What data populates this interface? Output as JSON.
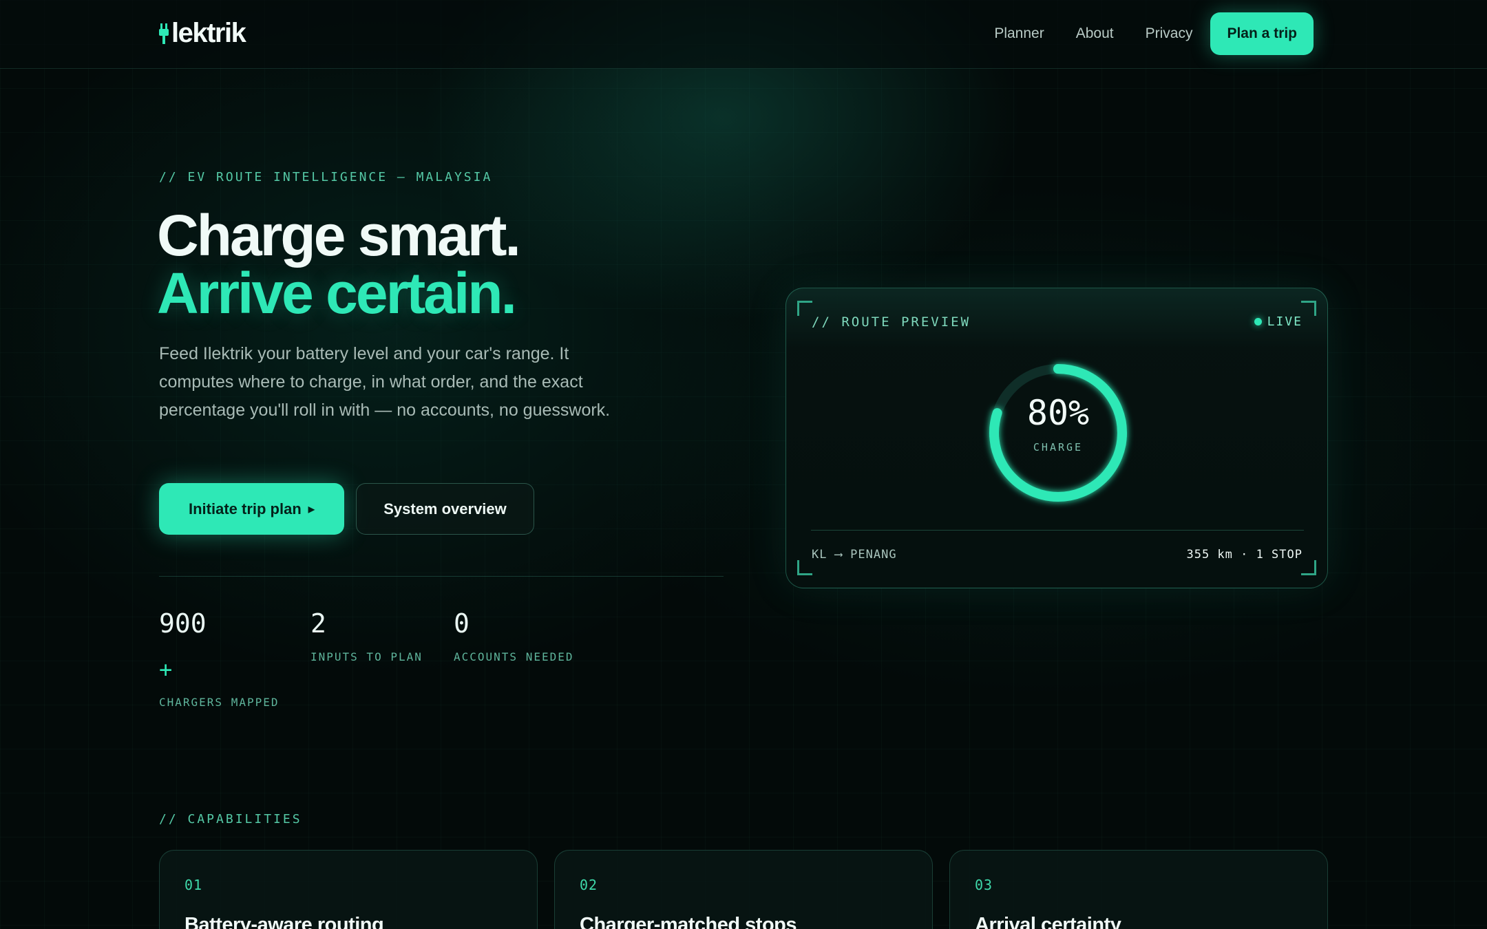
{
  "brand": {
    "name": "lektrik",
    "accent": "#2ee8b6",
    "background": "#030a09"
  },
  "nav": {
    "links": [
      "Planner",
      "About",
      "Privacy"
    ],
    "cta": "Plan a trip"
  },
  "hero": {
    "eyebrow": "// EV ROUTE INTELLIGENCE — MALAYSIA",
    "headline_1": "Charge smart.",
    "headline_2": "Arrive certain.",
    "lede": "Feed Ilektrik your battery level and your car's range. It computes where to charge, in what order, and the exact percentage you'll roll in with — no accounts, no guesswork.",
    "primary_cta": "Initiate trip plan",
    "primary_cta_icon": "play-triangle-icon",
    "secondary_cta": "System overview"
  },
  "stats": [
    {
      "value": "900",
      "suffix": "+",
      "label": "CHARGERS MAPPED"
    },
    {
      "value": "2",
      "label": "INPUTS TO PLAN"
    },
    {
      "value": "0",
      "label": "ACCOUNTS NEEDED"
    }
  ],
  "preview": {
    "title": "// ROUTE PREVIEW",
    "status": "LIVE",
    "charge_text": "80%",
    "charge_fraction": 0.8,
    "charge_label": "CHARGE",
    "route": "KL ⟶ PENANG",
    "summary": "355 km · 1 STOP"
  },
  "capabilities": {
    "eyebrow": "// CAPABILITIES",
    "items": [
      {
        "num": "01",
        "title": "Battery-aware routing"
      },
      {
        "num": "02",
        "title": "Charger-matched stops"
      },
      {
        "num": "03",
        "title": "Arrival certainty"
      }
    ]
  }
}
